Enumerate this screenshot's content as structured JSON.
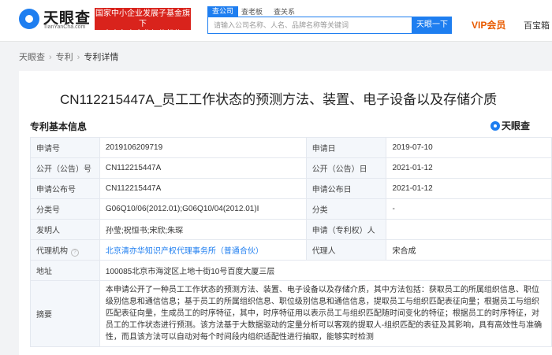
{
  "header": {
    "logo_text": "天眼查",
    "logo_sub": "TianYanCha.com",
    "promo_line1": "国家中小企业发展子基金旗下",
    "promo_line2": "官方备案企业征信机构",
    "search_tabs": [
      "查公司",
      "查老板",
      "查关系"
    ],
    "search_placeholder": "请输入公司名称、人名、品牌名称等关键词",
    "search_button": "天眼一下",
    "vip_label": "VIP会员",
    "user_name": "百宝箱"
  },
  "breadcrumb": [
    "天眼查",
    "专利",
    "专利详情"
  ],
  "page_title": "CN112215447A_员工工作状态的预测方法、装置、电子设备以及存储介质",
  "section_title": "专利基本信息",
  "watermark": "天眼查",
  "rows": {
    "r1": {
      "l1": "申请号",
      "v1": "2019106209719",
      "l2": "申请日",
      "v2": "2019-07-10"
    },
    "r2": {
      "l1": "公开（公告）号",
      "v1": "CN112215447A",
      "l2": "公开（公告）日",
      "v2": "2021-01-12"
    },
    "r3": {
      "l1": "申请公布号",
      "v1": "CN112215447A",
      "l2": "申请公布日",
      "v2": "2021-01-12"
    },
    "r4": {
      "l1": "分类号",
      "v1": "G06Q10/06(2012.01);G06Q10/04(2012.01)I",
      "l2": "分类",
      "v2": "-"
    },
    "r5": {
      "l1": "发明人",
      "v1": "孙莹;祝恒书;宋欣;朱琛",
      "l2": "申请（专利权）人",
      "v2": ""
    },
    "r6": {
      "l1": "代理机构",
      "v1": "北京清亦华知识产权代理事务所（普通合伙）",
      "l2": "代理人",
      "v2": "宋合成"
    },
    "r7": {
      "l1": "地址",
      "v1": "100085北京市海淀区上地十街10号百度大厦三层"
    },
    "r8": {
      "l1": "摘要",
      "v1": "本申请公开了一种员工工作状态的预测方法、装置、电子设备以及存储介质，其中方法包括：获取员工的所属组织信息、职位级别信息和通信信息；基于员工的所属组织信息、职位级别信息和通信信息，提取员工与组织匹配表征向量；根据员工与组织匹配表征向量，生成员工的时序特征，其中，时序特征用以表示员工与组织匹配随时间变化的特征；根据员工的时序特征，对员工的工作状态进行预测。该方法基于大数据驱动的定量分析可以客观的提取人-组织匹配的表征及其影响，具有高效性与准确性，而且该方法可以自动对每个时间段内组织适配性进行抽取，能够实时检测"
    }
  }
}
